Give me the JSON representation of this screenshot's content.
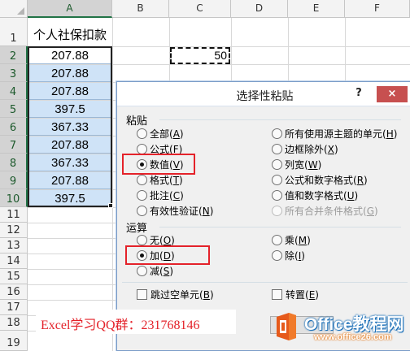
{
  "sheet": {
    "columns": [
      "A",
      "B",
      "C",
      "D",
      "E",
      "F"
    ],
    "rows": [
      "1",
      "2",
      "3",
      "4",
      "5",
      "6",
      "7",
      "8",
      "9",
      "10",
      "11",
      "12",
      "13",
      "14",
      "15",
      "16",
      "17",
      "18",
      "19"
    ],
    "header_cell": "个人社保扣款",
    "values": [
      "207.88",
      "207.88",
      "207.88",
      "397.5",
      "367.33",
      "207.88",
      "367.33",
      "207.88",
      "397.5"
    ],
    "copied_value": "50"
  },
  "dialog": {
    "title": "选择性粘贴",
    "help": "?",
    "close": "×",
    "paste_group": "粘贴",
    "paste_left": [
      {
        "label": "全部",
        "key": "A"
      },
      {
        "label": "公式",
        "key": "F"
      },
      {
        "label": "数值",
        "key": "V"
      },
      {
        "label": "格式",
        "key": "T"
      },
      {
        "label": "批注",
        "key": "C"
      },
      {
        "label": "有效性验证",
        "key": "N"
      }
    ],
    "paste_right": [
      {
        "label": "所有使用源主题的单元",
        "key": "H"
      },
      {
        "label": "边框除外",
        "key": "X"
      },
      {
        "label": "列宽",
        "key": "W"
      },
      {
        "label": "公式和数字格式",
        "key": "R"
      },
      {
        "label": "值和数字格式",
        "key": "U"
      },
      {
        "label": "所有合并条件格式",
        "key": "G"
      }
    ],
    "operation_group": "运算",
    "op_left": [
      {
        "label": "无",
        "key": "O"
      },
      {
        "label": "加",
        "key": "D"
      },
      {
        "label": "减",
        "key": "S"
      }
    ],
    "op_right": [
      {
        "label": "乘",
        "key": "M"
      },
      {
        "label": "除",
        "key": "I"
      }
    ],
    "skip_blanks": {
      "label": "跳过空单元",
      "key": "B"
    },
    "transpose": {
      "label": "转置",
      "key": "E"
    }
  },
  "overlay": {
    "qq_text": "Excel学习QQ群：231768146",
    "logo_main": "Office教程网",
    "logo_url": "www.office26.com"
  },
  "colors": {
    "selection_fill": "#cfe3f7",
    "highlight_red": "#e4222a",
    "excel_green": "#217346"
  }
}
